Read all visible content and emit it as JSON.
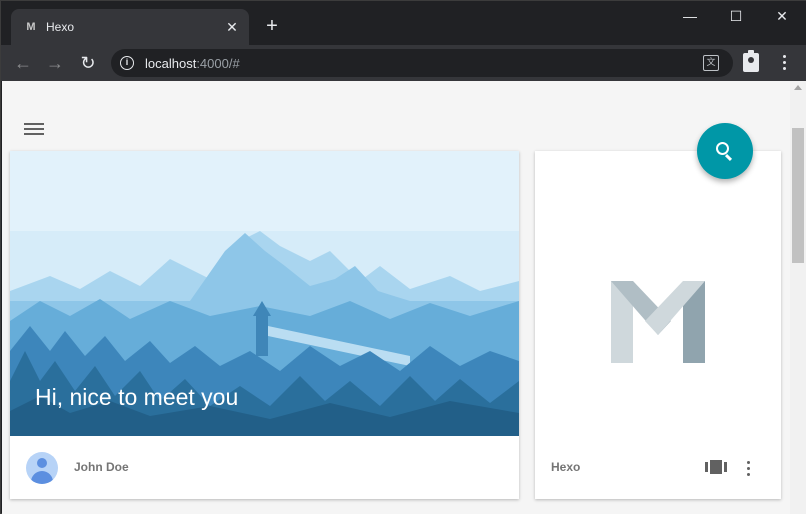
{
  "browser": {
    "tab_favicon": "M",
    "tab_title": "Hexo",
    "tab_close": "✕",
    "new_tab": "+",
    "window_controls": {
      "minimize": "—",
      "maximize": "☐",
      "close": "✕"
    },
    "url_host": "localhost",
    "url_rest": ":4000/#",
    "info_icon": "i",
    "translate_icon": "文"
  },
  "page": {
    "hero_title": "Hi, nice to meet you",
    "author": "John Doe",
    "site_name": "Hexo"
  },
  "colors": {
    "accent": "#0097a7",
    "sky": "#d6ecf9",
    "mountain": "#8ec6e8",
    "forest": "#2a6f9c"
  }
}
